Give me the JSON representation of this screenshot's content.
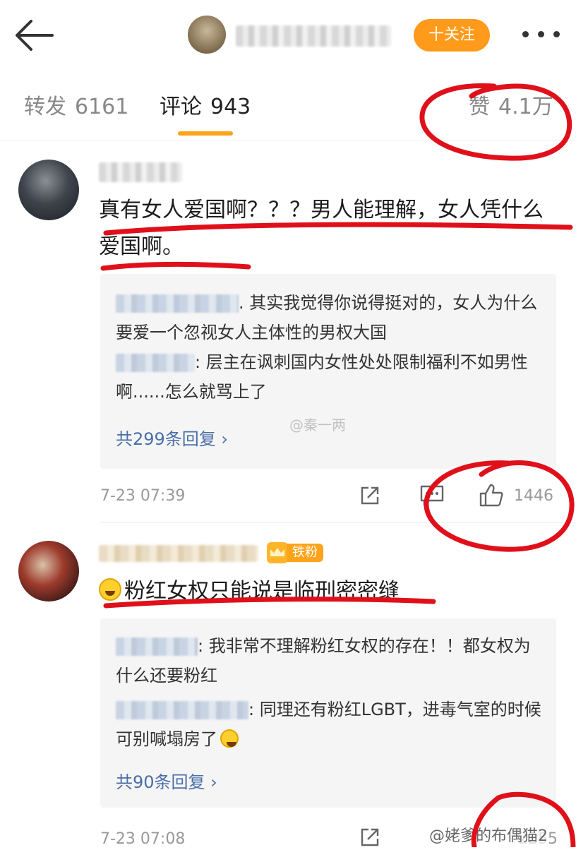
{
  "header": {
    "follow_label": "十关注"
  },
  "tabs": {
    "repost_label": "转发",
    "repost_count": "6161",
    "comment_label": "评论",
    "comment_count": "943",
    "likes_label": "赞",
    "likes_count": "4.1万"
  },
  "comments": [
    {
      "text": "真有女人爱国啊？？？男人能理解，女人凭什么爱国啊。",
      "replies": [
        {
          "text": ". 其实我觉得你说得挺对的，女人为什么要爱一个忽视女人主体性的男权大国"
        },
        {
          "text": ": 层主在讽刺国内女性处处限制福利不如男性啊......怎么就骂上了"
        }
      ],
      "more_replies": "共299条回复 ›",
      "time": "7-23 07:39",
      "likes": "1446"
    },
    {
      "badge": "铁粉",
      "text": "粉红女权只能说是临刑密密缝",
      "replies": [
        {
          "text": ": 我非常不理解粉红女权的存在！！都女权为什么还要粉红"
        },
        {
          "text": ": 同理还有粉红LGBT，进毒气室的时候可别喊塌房了"
        }
      ],
      "more_replies": "共90条回复 ›",
      "time": "7-23 07:08",
      "likes": "2255"
    }
  ],
  "watermarks": {
    "middle": "@秦一两",
    "bottom": "@姥爹的布偶猫2"
  },
  "colors": {
    "accent": "#ffa31a",
    "link": "#4a6ea8",
    "annotation_red": "#e0101b"
  }
}
